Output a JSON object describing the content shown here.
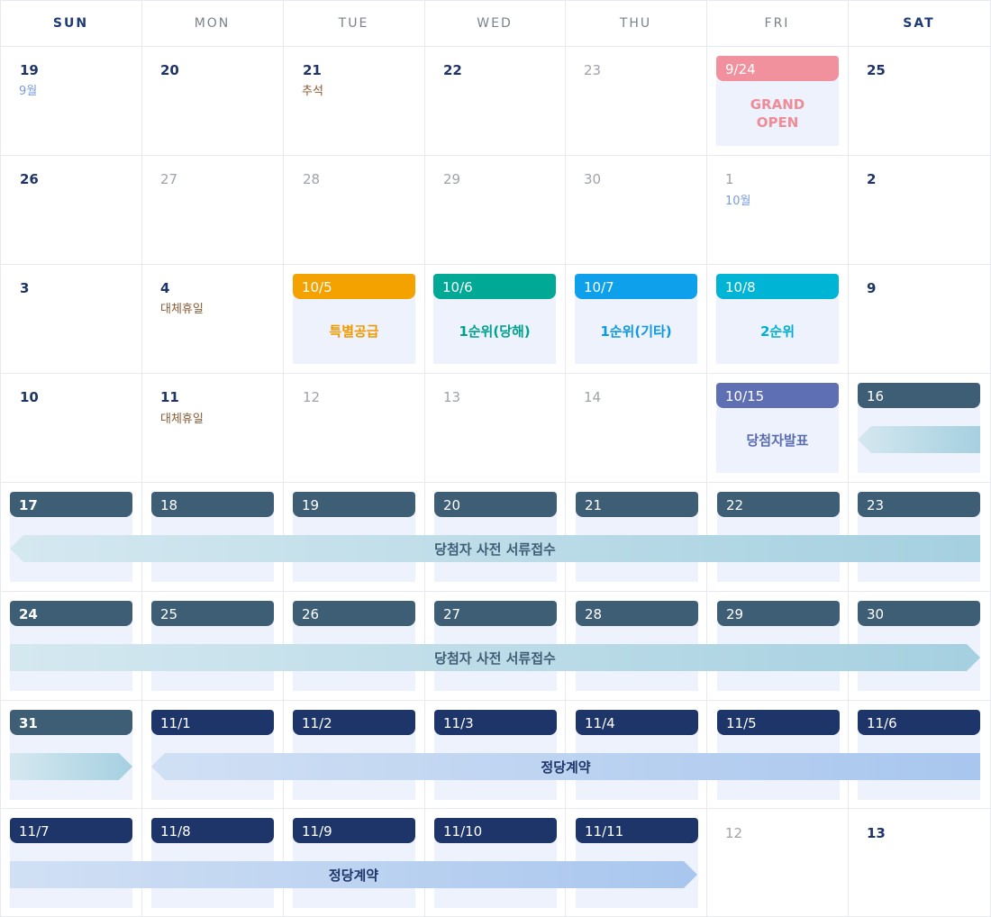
{
  "weekdays": [
    "SUN",
    "MON",
    "TUE",
    "WED",
    "THU",
    "FRI",
    "SAT"
  ],
  "dates": {
    "r1": [
      "19",
      "20",
      "21",
      "22",
      "23",
      "25"
    ],
    "r2": [
      "26",
      "27",
      "28",
      "29",
      "30",
      "1",
      "2"
    ],
    "r3": [
      "3",
      "4",
      "9"
    ],
    "r4": [
      "10",
      "11",
      "12",
      "13",
      "14"
    ],
    "r8": [
      "12",
      "13"
    ]
  },
  "notes": {
    "september": "9월",
    "october": "10월",
    "chuseok": "추석",
    "substitute_holiday": "대체휴일"
  },
  "events": {
    "grand_open": {
      "date": "9/24",
      "title": "GRAND\nOPEN"
    },
    "special_supply": {
      "date": "10/5",
      "title": "특별공급"
    },
    "first_rank_local": {
      "date": "10/6",
      "title": "1순위(당해)"
    },
    "first_rank_other": {
      "date": "10/7",
      "title": "1순위(기타)"
    },
    "second_rank": {
      "date": "10/8",
      "title": "2순위"
    },
    "winner_announce": {
      "date": "10/15",
      "title": "당첨자발표"
    }
  },
  "span_headers": {
    "r4_sat": "16",
    "r5": [
      "17",
      "18",
      "19",
      "20",
      "21",
      "22",
      "23"
    ],
    "r6": [
      "24",
      "25",
      "26",
      "27",
      "28",
      "29",
      "30"
    ],
    "r7": [
      "31",
      "11/1",
      "11/2",
      "11/3",
      "11/4",
      "11/5",
      "11/6"
    ],
    "r8": [
      "11/7",
      "11/8",
      "11/9",
      "11/10",
      "11/11"
    ]
  },
  "bars": {
    "docs_label": "당첨자 사전 서류접수",
    "contract_label": "정당계약"
  },
  "colors": {
    "grand_open": "#f0919d",
    "special_supply": "#f4a200",
    "first_rank_local": "#00a896",
    "first_rank_other": "#0fa0ec",
    "second_rank": "#00b4d6",
    "winner_announce": "#5f6fb3",
    "docs_period": "#3e5e76",
    "contract_period": "#1e3569"
  }
}
